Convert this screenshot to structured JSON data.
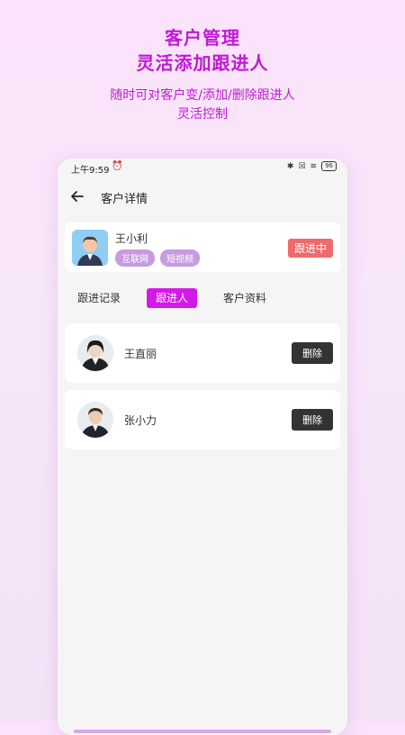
{
  "promo": {
    "title_line1": "客户管理",
    "title_line2": "灵活添加跟进人",
    "sub_line1": "随时可对客户变/添加/删除跟进人",
    "sub_line2": "灵活控制"
  },
  "status_bar": {
    "time": "上午9:59",
    "battery": "96"
  },
  "header": {
    "title": "客户详情"
  },
  "customer": {
    "name": "王小利",
    "tags": [
      "互联网",
      "短视频"
    ],
    "status": "跟进中"
  },
  "tabs": [
    {
      "label": "跟进记录",
      "active": false
    },
    {
      "label": "跟进人",
      "active": true
    },
    {
      "label": "客户资料",
      "active": false
    }
  ],
  "followers": [
    {
      "name": "王直丽",
      "action": "删除"
    },
    {
      "name": "张小力",
      "action": "删除"
    }
  ],
  "colors": {
    "accent": "#d418e8",
    "status_badge": "#ef6a6a",
    "tag": "#c79be0",
    "button": "#333333"
  }
}
